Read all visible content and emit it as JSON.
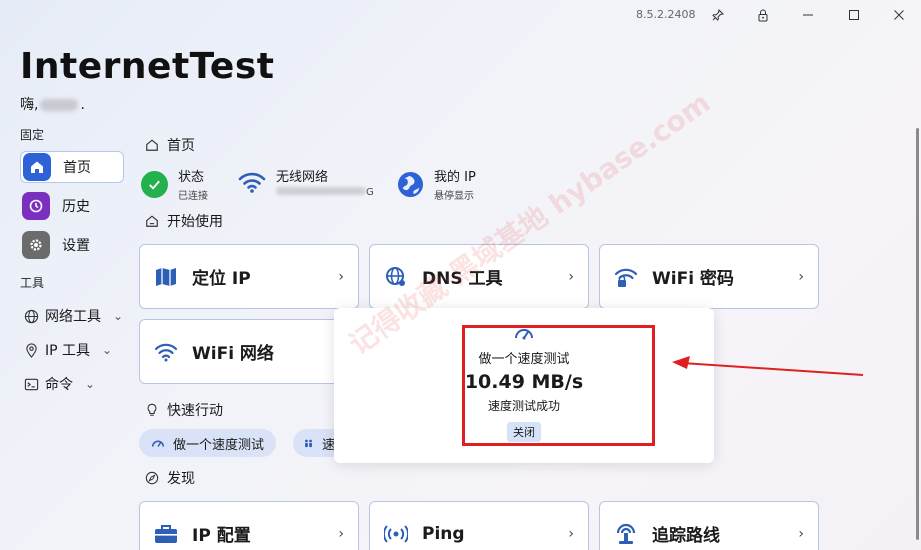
{
  "window": {
    "version": "8.5.2.2408",
    "pin_icon": "pin-icon",
    "lock_icon": "lock-icon"
  },
  "app": {
    "title": "InternetTest",
    "greeting": "嗨,",
    "greeting_end": "."
  },
  "sidebar": {
    "pinned_label": "固定",
    "items": [
      {
        "label": "首页",
        "icon": "home-icon",
        "color": "#2d63d6"
      },
      {
        "label": "历史",
        "icon": "history-icon",
        "color": "#7b2fbf"
      },
      {
        "label": "设置",
        "icon": "gear-icon",
        "color": "#6b6b6b"
      }
    ],
    "tools_label": "工具",
    "tools": [
      {
        "label": "网络工具",
        "icon": "globe-icon"
      },
      {
        "label": "IP 工具",
        "icon": "location-icon"
      },
      {
        "label": "命令",
        "icon": "terminal-icon"
      }
    ]
  },
  "main": {
    "breadcrumb": "首页",
    "status": {
      "title": "状态",
      "sub": "已连接",
      "color": "#22b14c"
    },
    "wifi": {
      "title": "无线网络",
      "sub_suffix": "G"
    },
    "myip": {
      "title": "我的 IP",
      "sub": "悬停显示"
    },
    "get_started": "开始使用",
    "cards": [
      {
        "label": "定位 IP",
        "icon": "map-icon"
      },
      {
        "label": "DNS 工具",
        "icon": "dns-globe-icon"
      },
      {
        "label": "WiFi 密码",
        "icon": "wifi-lock-icon"
      },
      {
        "label": "WiFi 网络",
        "icon": "wifi-icon"
      }
    ],
    "quick_actions_label": "快速行动",
    "quick_actions": [
      {
        "label": "做一个速度测试",
        "icon": "speedometer-icon"
      },
      {
        "label": "速",
        "icon": "people-icon"
      }
    ],
    "discover_label": "发现",
    "discover_cards": [
      {
        "label": "IP 配置",
        "icon": "toolbox-icon"
      },
      {
        "label": "Ping",
        "icon": "ping-icon"
      },
      {
        "label": "追踪路线",
        "icon": "route-icon"
      }
    ]
  },
  "toast": {
    "title": "做一个速度测试",
    "speed": "10.49 MB/s",
    "status": "速度测试成功",
    "close": "关闭",
    "icon": "speedometer-icon"
  },
  "annotation": {
    "color": "#e02020"
  },
  "watermark": "记得收藏·黑域基地 hybase.com"
}
